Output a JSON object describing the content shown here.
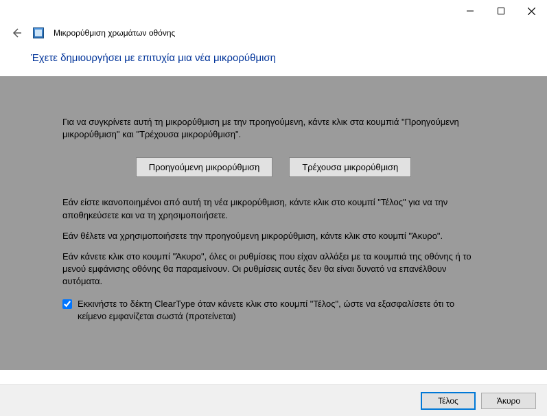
{
  "window": {
    "app_title": "Μικρορύθμιση χρωμάτων οθόνης"
  },
  "heading": "Έχετε δημιουργήσει με επιτυχία μια νέα μικρορύθμιση",
  "content": {
    "intro": "Για να συγκρίνετε αυτή τη μικρορύθμιση με την προηγούμενη, κάντε κλικ στα κουμπιά \"Προηγούμενη μικρορύθμιση\" και \"Τρέχουσα μικρορύθμιση\".",
    "prev_btn": "Προηγούμενη μικρορύθμιση",
    "curr_btn": "Τρέχουσα μικρορύθμιση",
    "para2": "Εάν είστε ικανοποιημένοι από αυτή τη νέα μικρορύθμιση, κάντε κλικ στο κουμπί \"Τέλος\" για να την αποθηκεύσετε και να τη χρησιμοποιήσετε.",
    "para3": "Εάν θέλετε να χρησιμοποιήσετε την προηγούμενη μικρορύθμιση, κάντε κλικ στο κουμπί \"Άκυρο\".",
    "para4": "Εάν κάνετε κλικ στο κουμπί \"Άκυρο\", όλες οι ρυθμίσεις που είχαν αλλάξει με τα κουμπιά της οθόνης ή το μενού εμφάνισης οθόνης θα παραμείνουν. Οι ρυθμίσεις αυτές δεν θα είναι δυνατό να επανέλθουν αυτόματα.",
    "checkbox_label": "Εκκινήστε το δέκτη ClearType όταν κάνετε κλικ στο κουμπί \"Τέλος\", ώστε να εξασφαλίσετε ότι το κείμενο εμφανίζεται σωστά (προτείνεται)",
    "checkbox_checked": true
  },
  "footer": {
    "finish": "Τέλος",
    "cancel": "Άκυρο"
  }
}
